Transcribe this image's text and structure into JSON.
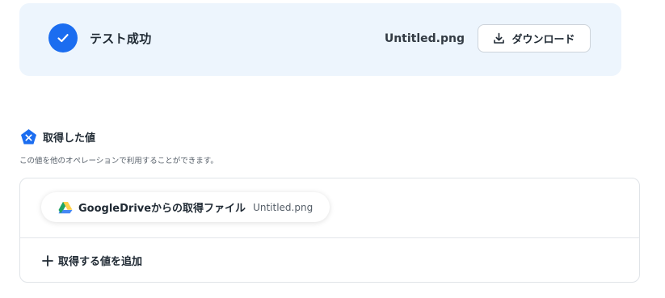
{
  "banner": {
    "status_text": "テスト成功",
    "file_name": "Untitled.png",
    "download_label": "ダウンロード",
    "status_icon": "check-icon",
    "accent_color": "#1b6df0",
    "background_color": "#edf5fd"
  },
  "section": {
    "title": "取得した値",
    "description": "この値を他のオペレーションで利用することができます。",
    "icon": "variable-pentagon-icon"
  },
  "values": [
    {
      "label": "GoogleDriveからの取得ファイル",
      "value": "Untitled.png",
      "icon": "google-drive-icon"
    }
  ],
  "add_value_label": "取得する値を追加"
}
